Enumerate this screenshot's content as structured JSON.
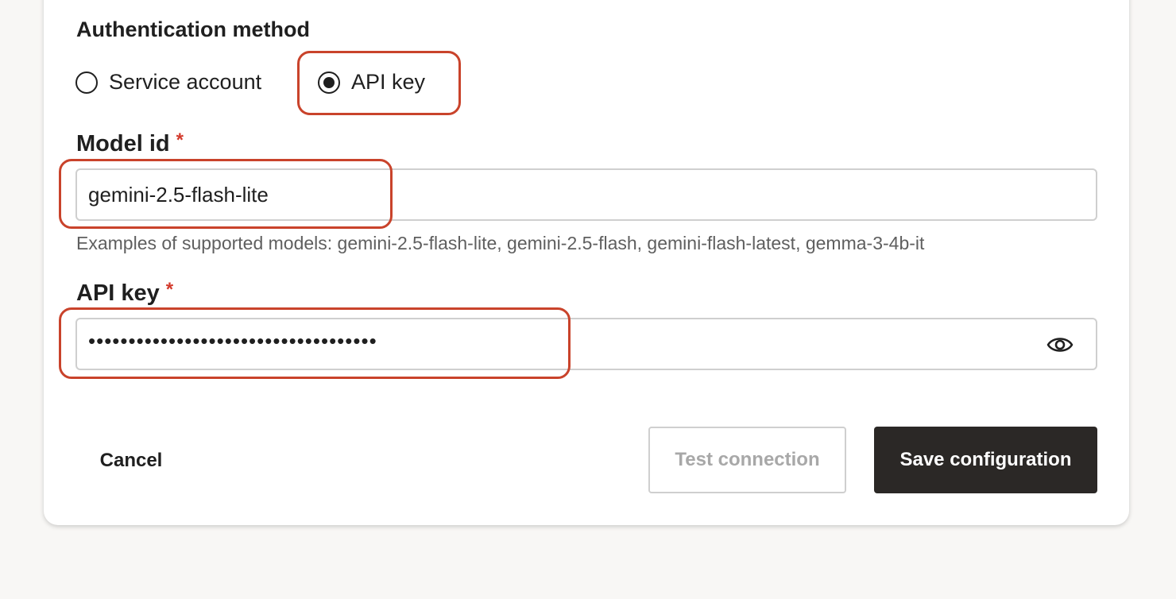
{
  "auth": {
    "title": "Authentication method",
    "options": [
      {
        "label": "Service account",
        "selected": false
      },
      {
        "label": "API key",
        "selected": true
      }
    ]
  },
  "model": {
    "label": "Model id",
    "required_mark": "*",
    "value": "gemini-2.5-flash-lite",
    "helper": "Examples of supported models: gemini-2.5-flash-lite, gemini-2.5-flash, gemini-flash-latest, gemma-3-4b-it"
  },
  "api_key": {
    "label": "API key",
    "required_mark": "*",
    "masked_value": "••••••••••••••••••••••••••••••••••••",
    "reveal_icon": "eye-icon"
  },
  "actions": {
    "cancel_label": "Cancel",
    "test_label": "Test connection",
    "save_label": "Save configuration"
  },
  "colors": {
    "highlight": "#c9432b",
    "required": "#d33a2c",
    "primary_button": "#2b2826"
  }
}
